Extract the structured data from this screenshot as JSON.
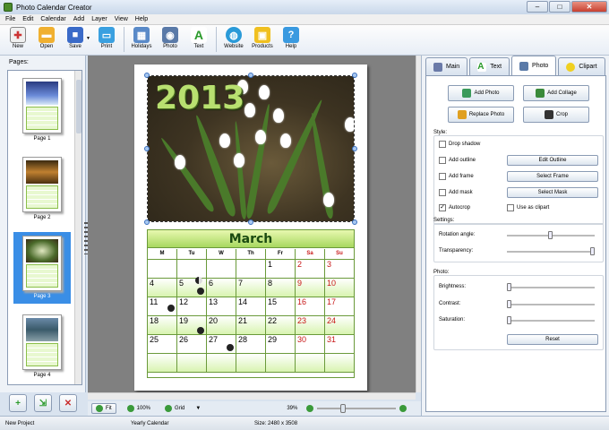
{
  "window": {
    "title": "Photo Calendar Creator",
    "minimize": "–",
    "maximize": "□",
    "close": "✕"
  },
  "menu": [
    "File",
    "Edit",
    "Calendar",
    "Add",
    "Layer",
    "View",
    "Help"
  ],
  "toolbar": {
    "new": "New",
    "open": "Open",
    "save": "Save",
    "print": "Print",
    "holidays": "Holidays",
    "photo": "Photo",
    "text": "Text",
    "website": "Website",
    "products": "Products",
    "help": "Help"
  },
  "pages": {
    "title": "Pages:",
    "items": [
      {
        "name": "Page 1"
      },
      {
        "name": "Page 2"
      },
      {
        "name": "Page 3"
      },
      {
        "name": "Page 4"
      }
    ]
  },
  "calendar": {
    "year": "2013",
    "month": "March",
    "days_of_week": [
      "M",
      "Tu",
      "W",
      "Th",
      "Fr",
      "Sa",
      "Su"
    ],
    "weeks": [
      [
        "",
        "",
        "",
        "",
        "1",
        "2",
        "3"
      ],
      [
        "4",
        "5",
        "6",
        "7",
        "8",
        "9",
        "10"
      ],
      [
        "11",
        "12",
        "13",
        "14",
        "15",
        "16",
        "17"
      ],
      [
        "18",
        "19",
        "20",
        "21",
        "22",
        "23",
        "24"
      ],
      [
        "25",
        "26",
        "27",
        "28",
        "29",
        "30",
        "31"
      ],
      [
        "",
        "",
        "",
        "",
        "",
        "",
        ""
      ]
    ],
    "weekend_color": "#c81818"
  },
  "zoombar": {
    "fit": "Fit",
    "zoom100": "100%",
    "grid": "Grid",
    "zoom_level": "39%"
  },
  "right_tabs": [
    "Main",
    "Text",
    "Photo",
    "Clipart"
  ],
  "photo_panel": {
    "add_photo": "Add Photo",
    "add_collage": "Add Collage",
    "replace_photo": "Replace Photo",
    "crop": "Crop",
    "style_label": "Style:",
    "drop_shadow": "Drop shadow",
    "add_outline": "Add outline",
    "edit_outline": "Edit Outline",
    "add_frame": "Add frame",
    "select_frame": "Select Frame",
    "add_mask": "Add mask",
    "select_mask": "Select Mask",
    "autocrop": "Autocrop",
    "use_as_clipart": "Use as clipart",
    "settings_label": "Settings:",
    "rotation_angle": "Rotation angle:",
    "transparency": "Transparency:",
    "photo_label": "Photo:",
    "brightness": "Brightness:",
    "contrast": "Contrast:",
    "saturation": "Saturation:",
    "reset": "Reset"
  },
  "status": {
    "project": "New Project",
    "type": "Yearly Calendar",
    "size": "Size: 2480 x 3508"
  },
  "colors": {
    "accent": "#3a8ee6",
    "calendar_green": "#a8d860",
    "grid_line": "#6a9a3a"
  }
}
